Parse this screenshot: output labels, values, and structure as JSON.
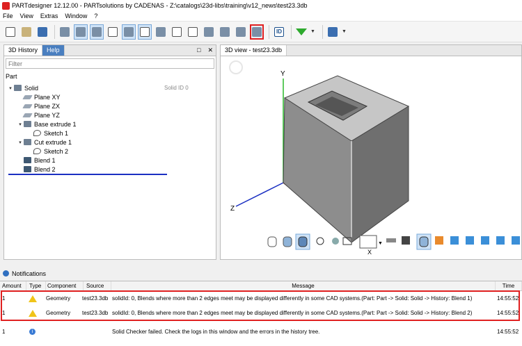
{
  "window": {
    "title": "PARTdesigner 12.12.00 - PARTsolutions by CADENAS - Z:\\catalogs\\23d-libs\\training\\v12_news\\test23.3db"
  },
  "menu": [
    "File",
    "View",
    "Extras",
    "Window",
    "?"
  ],
  "left_panel": {
    "tabs": [
      "3D History",
      "Help"
    ],
    "controls": [
      "□",
      "✕"
    ],
    "filter_placeholder": "Filter",
    "root_label": "Part",
    "solid_id": "Solid ID 0",
    "tree": [
      {
        "label": "Solid",
        "expand": "▾",
        "icon": "solid-icon"
      },
      {
        "label": "Plane XY",
        "expand": "",
        "icon": "plane-icon"
      },
      {
        "label": "Plane ZX",
        "expand": "",
        "icon": "plane-icon"
      },
      {
        "label": "Plane YZ",
        "expand": "",
        "icon": "plane-icon"
      },
      {
        "label": "Base extrude 1",
        "expand": "▾",
        "icon": "extrude-icon"
      },
      {
        "label": "Sketch 1",
        "expand": "",
        "icon": "sketch-icon"
      },
      {
        "label": "Cut extrude 1",
        "expand": "▾",
        "icon": "cut-extrude-icon"
      },
      {
        "label": "Sketch 2",
        "expand": "",
        "icon": "sketch-icon"
      },
      {
        "label": "Blend 1",
        "expand": "",
        "icon": "blend-icon"
      },
      {
        "label": "Blend 2",
        "expand": "",
        "icon": "blend-icon"
      }
    ]
  },
  "view_panel": {
    "tab": "3D view - test23.3db",
    "axis_y": "Y",
    "axis_z": "Z",
    "axis_x": "X"
  },
  "notifications": {
    "title": "Notifications",
    "columns": [
      "Amount",
      "Type",
      "Component",
      "Source",
      "Message",
      "Time"
    ],
    "rows": [
      {
        "amount": "1",
        "type": "warning-icon",
        "component": "Geometry",
        "source": "test23.3db",
        "message": "solidId: 0, Blends where more than 2 edges meet may be displayed differently in some CAD systems.(Part: Part -> Solid: Solid -> History: Blend 1)",
        "time": "14:55:52"
      },
      {
        "amount": "1",
        "type": "warning-icon",
        "component": "Geometry",
        "source": "test23.3db",
        "message": "solidId: 0, Blends where more than 2 edges meet may be displayed differently in some CAD systems.(Part: Part -> Solid: Solid -> History: Blend 2)",
        "time": "14:55:52"
      },
      {
        "amount": "1",
        "type": "info-icon",
        "component": "",
        "source": "",
        "message": "Solid Checker failed. Check the logs in this window and the errors in the history tree.",
        "time": "14:55:52"
      }
    ]
  },
  "colors": {
    "highlight": "#e02020",
    "selection_line": "#1a2fc2",
    "warning": "#f0c419",
    "info": "#3a7bd5"
  }
}
